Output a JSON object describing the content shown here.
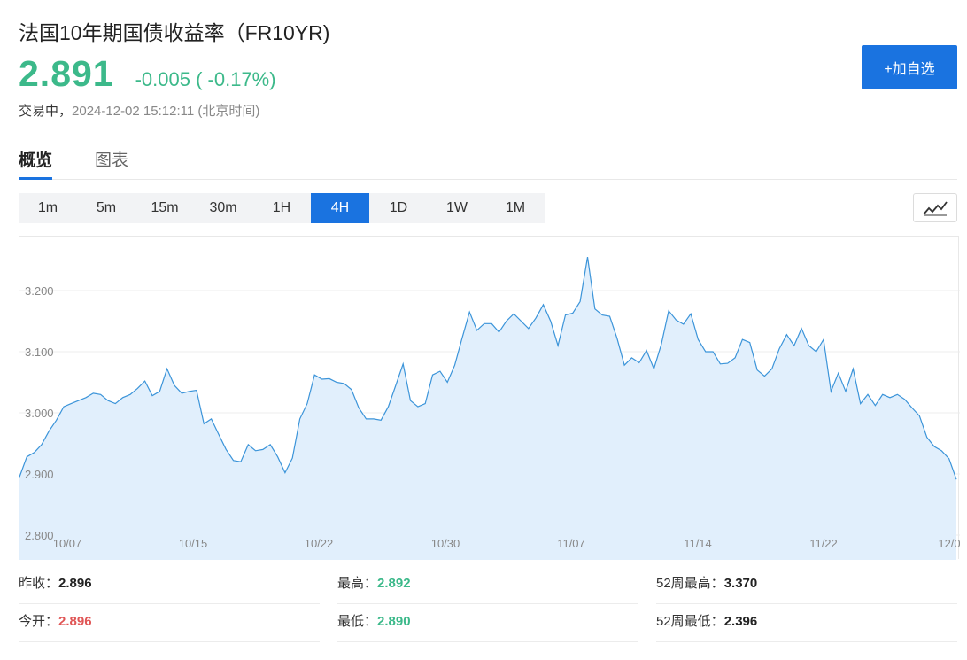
{
  "header": {
    "title": "法国10年期国债收益率（FR10YR)",
    "price": "2.891",
    "change": "-0.005 ( -0.17%)",
    "status": "交易中，",
    "time": "2024-12-02 15:12:11 (北京时间)",
    "add_button": "+加自选"
  },
  "tabs": [
    {
      "label": "概览",
      "active": true
    },
    {
      "label": "图表",
      "active": false
    }
  ],
  "periods": [
    {
      "label": "1m"
    },
    {
      "label": "5m"
    },
    {
      "label": "15m"
    },
    {
      "label": "30m"
    },
    {
      "label": "1H"
    },
    {
      "label": "4H",
      "active": true
    },
    {
      "label": "1D"
    },
    {
      "label": "1W"
    },
    {
      "label": "1M"
    }
  ],
  "chart_type_icon": "line-chart-icon",
  "colors": {
    "accent": "#1a73e0",
    "up_green": "#3cb98a",
    "down_red": "#e05656",
    "line": "#3b94d9",
    "area": "#e1effc"
  },
  "chart_data": {
    "type": "area",
    "y_ticks": [
      "3.200",
      "3.100",
      "3.000",
      "2.900",
      "2.800"
    ],
    "y_tick_values": [
      3.2,
      3.1,
      3.0,
      2.9,
      2.8
    ],
    "ylim": [
      2.8,
      3.2
    ],
    "x_ticks": [
      "10/07",
      "10/15",
      "10/22",
      "10/30",
      "11/07",
      "11/14",
      "11/22",
      "12/0"
    ],
    "grid": true,
    "values": [
      2.895,
      2.928,
      2.935,
      2.948,
      2.97,
      2.988,
      3.01,
      3.015,
      3.02,
      3.025,
      3.032,
      3.03,
      3.02,
      3.015,
      3.025,
      3.03,
      3.04,
      3.052,
      3.028,
      3.035,
      3.072,
      3.045,
      3.032,
      3.035,
      3.037,
      2.982,
      2.99,
      2.965,
      2.94,
      2.922,
      2.92,
      2.948,
      2.938,
      2.94,
      2.948,
      2.928,
      2.902,
      2.926,
      2.99,
      3.015,
      3.062,
      3.055,
      3.056,
      3.05,
      3.048,
      3.038,
      3.008,
      2.99,
      2.99,
      2.988,
      3.01,
      3.045,
      3.08,
      3.02,
      3.01,
      3.015,
      3.062,
      3.068,
      3.05,
      3.078,
      3.122,
      3.165,
      3.135,
      3.146,
      3.146,
      3.132,
      3.15,
      3.162,
      3.15,
      3.138,
      3.155,
      3.177,
      3.15,
      3.11,
      3.16,
      3.163,
      3.182,
      3.255,
      3.17,
      3.16,
      3.158,
      3.122,
      3.078,
      3.09,
      3.082,
      3.102,
      3.072,
      3.112,
      3.167,
      3.152,
      3.145,
      3.162,
      3.12,
      3.1,
      3.1,
      3.08,
      3.081,
      3.09,
      3.12,
      3.115,
      3.07,
      3.06,
      3.072,
      3.105,
      3.128,
      3.11,
      3.138,
      3.11,
      3.1,
      3.12,
      3.035,
      3.065,
      3.035,
      3.072,
      3.015,
      3.03,
      3.012,
      3.03,
      3.025,
      3.03,
      3.022,
      3.008,
      2.995,
      2.96,
      2.945,
      2.938,
      2.925,
      2.891
    ]
  },
  "stats": [
    [
      {
        "label": "昨收：",
        "value": "2.896",
        "color": "normal"
      },
      {
        "label": "最高：",
        "value": "2.892",
        "color": "green"
      },
      {
        "label": "52周最高：",
        "value": "3.370",
        "color": "normal"
      }
    ],
    [
      {
        "label": "今开：",
        "value": "2.896",
        "color": "red"
      },
      {
        "label": "最低：",
        "value": "2.890",
        "color": "green"
      },
      {
        "label": "52周最低：",
        "value": "2.396",
        "color": "normal"
      }
    ]
  ]
}
